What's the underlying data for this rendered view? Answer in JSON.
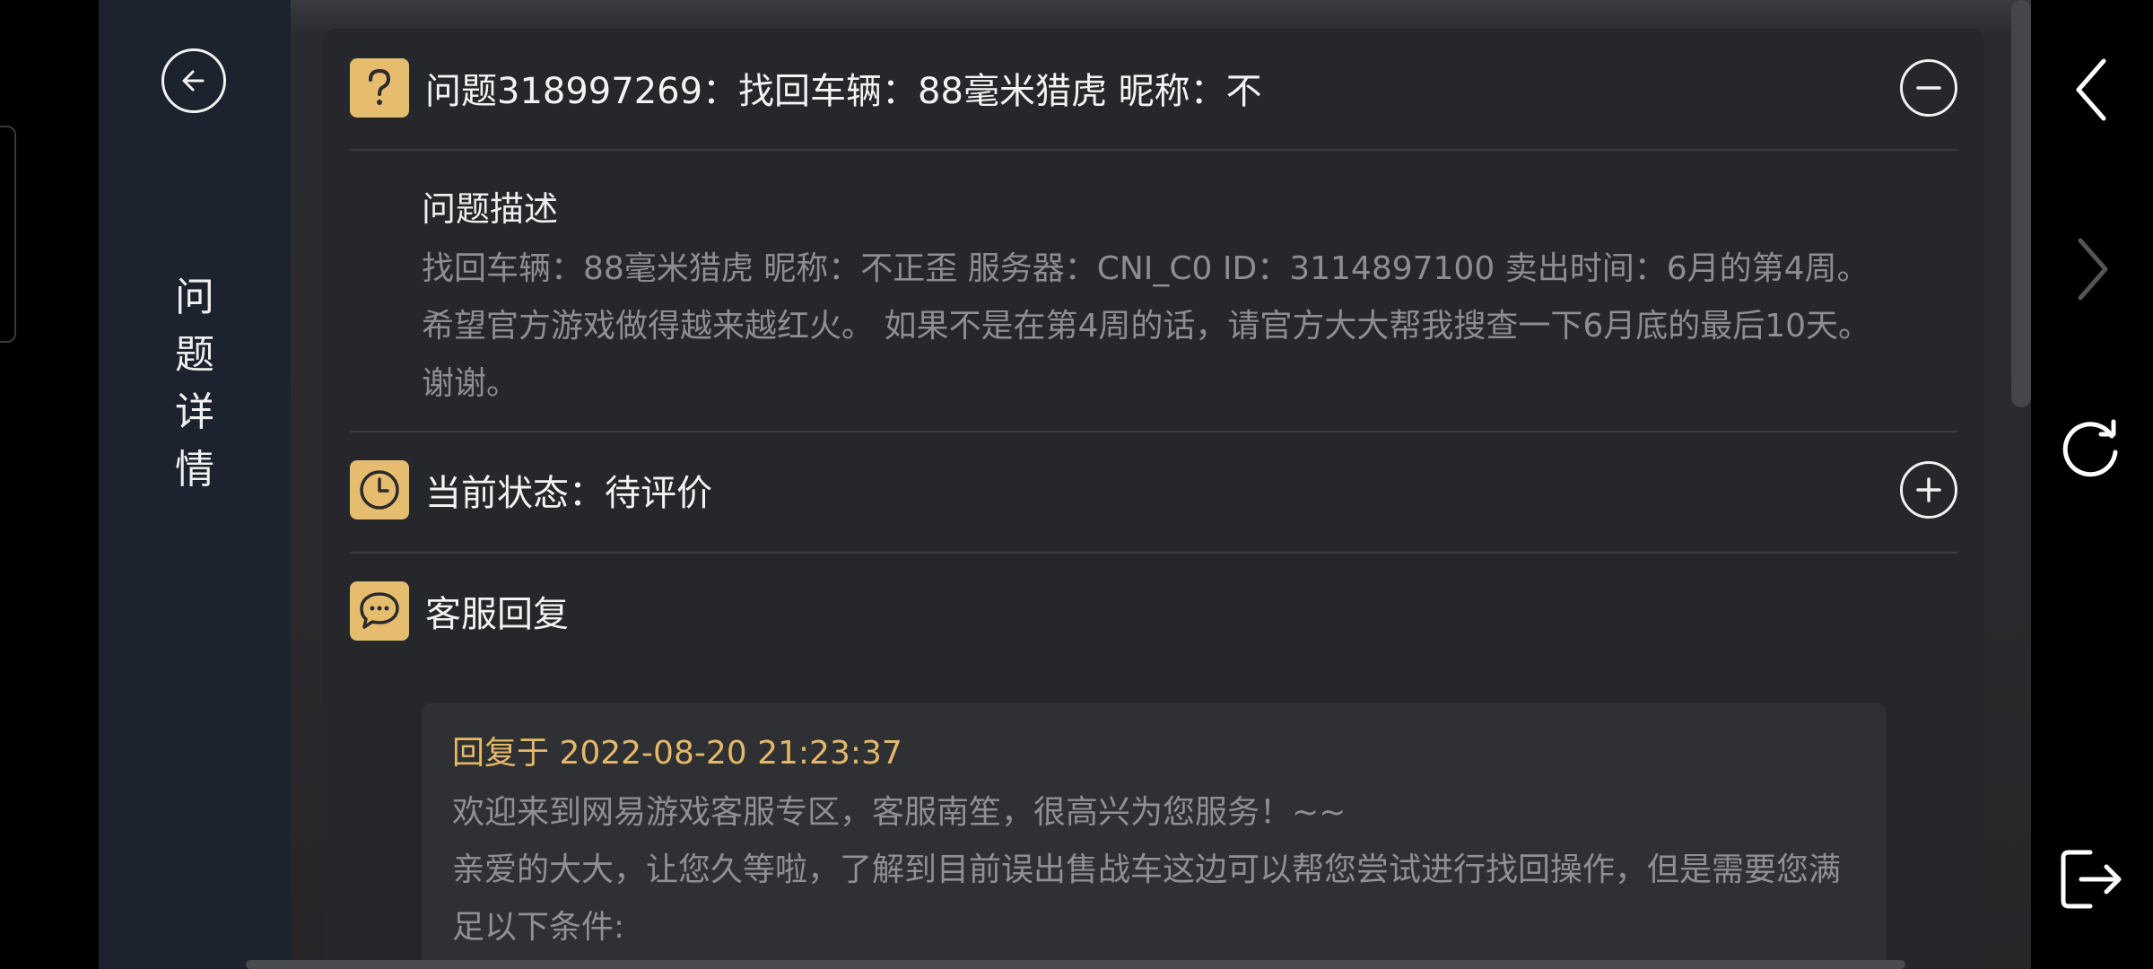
{
  "sidebar": {
    "title_chars": [
      "问",
      "题",
      "详",
      "情"
    ]
  },
  "question": {
    "title": "问题318997269：找回车辆：88毫米猎虎 昵称：不",
    "icon": "question-icon",
    "toggle_icon": "minus-circle-icon"
  },
  "description": {
    "label": "问题描述",
    "text": "找回车辆：88毫米猎虎 昵称：不正歪 服务器：CNI_C0 ID：3114897100 卖出时间：6月的第4周。 希望官方游戏做得越来越红火。 如果不是在第4周的话，请官方大大帮我搜查一下6月底的最后10天。谢谢。"
  },
  "status": {
    "title": "当前状态：待评价",
    "icon": "clock-icon",
    "toggle_icon": "plus-circle-icon"
  },
  "reply": {
    "title": "客服回复",
    "icon": "chat-bubble-icon",
    "time": "回复于 2022-08-20 21:23:37",
    "line1": "欢迎来到网易游戏客服专区，客服南笙，很高兴为您服务！~~",
    "line2": "亲爱的大大，让您久等啦，了解到目前误出售战车这边可以帮您尝试进行找回操作，但是需要您满足以下条件:"
  },
  "colors": {
    "accent": "#e6bd6e",
    "sidebar_bg": "#1c222e",
    "card_bg": "#26272b",
    "muted_text": "#8d8e92"
  },
  "nav_icons": [
    "back-arrow-icon",
    "forward-arrow-icon",
    "refresh-icon",
    "exit-icon"
  ]
}
